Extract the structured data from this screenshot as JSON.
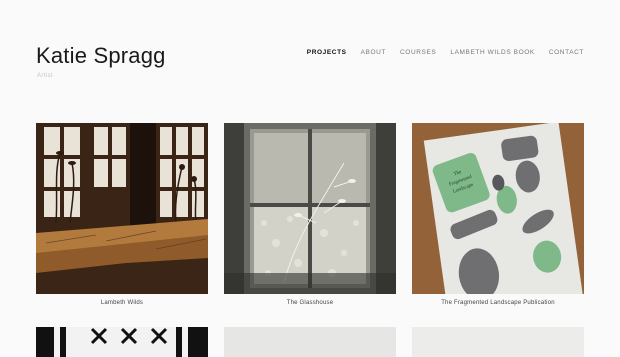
{
  "site": {
    "title": "Katie Spragg",
    "tagline": "Artist"
  },
  "nav": [
    {
      "label": "PROJECTS",
      "active": true
    },
    {
      "label": "ABOUT",
      "active": false
    },
    {
      "label": "COURSES",
      "active": false
    },
    {
      "label": "LAMBETH WILDS BOOK",
      "active": false
    },
    {
      "label": "CONTACT",
      "active": false
    }
  ],
  "projects": [
    {
      "caption": "Lambeth Wilds"
    },
    {
      "caption": "The Glasshouse"
    },
    {
      "caption": "The Fragmented Landscape Publication"
    }
  ],
  "publication_cover": {
    "title_lines": [
      "The",
      "Fragmented",
      "Landscape"
    ]
  },
  "colors": {
    "background": "#fafafa",
    "nav_active": "#111111",
    "nav_inactive": "#777777",
    "publication_green": "#7fb98a"
  }
}
